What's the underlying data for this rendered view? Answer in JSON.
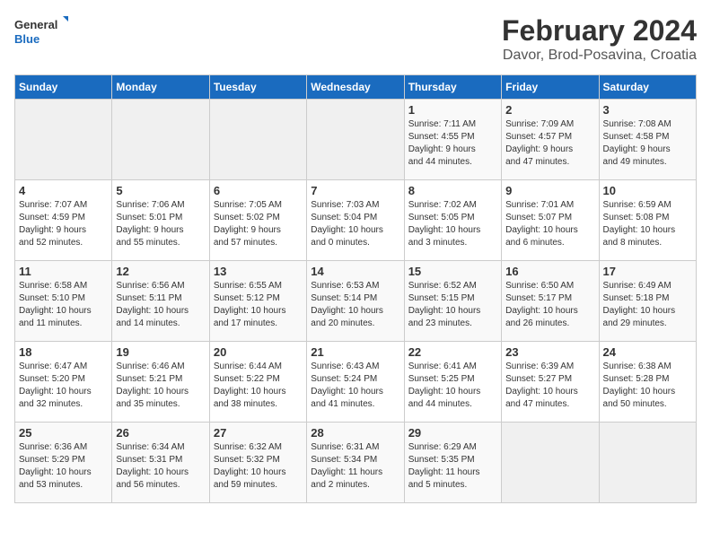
{
  "header": {
    "logo_general": "General",
    "logo_blue": "Blue",
    "title": "February 2024",
    "subtitle": "Davor, Brod-Posavina, Croatia"
  },
  "calendar": {
    "days_of_week": [
      "Sunday",
      "Monday",
      "Tuesday",
      "Wednesday",
      "Thursday",
      "Friday",
      "Saturday"
    ],
    "weeks": [
      {
        "days": [
          {
            "num": "",
            "info": "",
            "empty": true
          },
          {
            "num": "",
            "info": "",
            "empty": true
          },
          {
            "num": "",
            "info": "",
            "empty": true
          },
          {
            "num": "",
            "info": "",
            "empty": true
          },
          {
            "num": "1",
            "info": "Sunrise: 7:11 AM\nSunset: 4:55 PM\nDaylight: 9 hours\nand 44 minutes."
          },
          {
            "num": "2",
            "info": "Sunrise: 7:09 AM\nSunset: 4:57 PM\nDaylight: 9 hours\nand 47 minutes."
          },
          {
            "num": "3",
            "info": "Sunrise: 7:08 AM\nSunset: 4:58 PM\nDaylight: 9 hours\nand 49 minutes."
          }
        ]
      },
      {
        "days": [
          {
            "num": "4",
            "info": "Sunrise: 7:07 AM\nSunset: 4:59 PM\nDaylight: 9 hours\nand 52 minutes."
          },
          {
            "num": "5",
            "info": "Sunrise: 7:06 AM\nSunset: 5:01 PM\nDaylight: 9 hours\nand 55 minutes."
          },
          {
            "num": "6",
            "info": "Sunrise: 7:05 AM\nSunset: 5:02 PM\nDaylight: 9 hours\nand 57 minutes."
          },
          {
            "num": "7",
            "info": "Sunrise: 7:03 AM\nSunset: 5:04 PM\nDaylight: 10 hours\nand 0 minutes."
          },
          {
            "num": "8",
            "info": "Sunrise: 7:02 AM\nSunset: 5:05 PM\nDaylight: 10 hours\nand 3 minutes."
          },
          {
            "num": "9",
            "info": "Sunrise: 7:01 AM\nSunset: 5:07 PM\nDaylight: 10 hours\nand 6 minutes."
          },
          {
            "num": "10",
            "info": "Sunrise: 6:59 AM\nSunset: 5:08 PM\nDaylight: 10 hours\nand 8 minutes."
          }
        ]
      },
      {
        "days": [
          {
            "num": "11",
            "info": "Sunrise: 6:58 AM\nSunset: 5:10 PM\nDaylight: 10 hours\nand 11 minutes."
          },
          {
            "num": "12",
            "info": "Sunrise: 6:56 AM\nSunset: 5:11 PM\nDaylight: 10 hours\nand 14 minutes."
          },
          {
            "num": "13",
            "info": "Sunrise: 6:55 AM\nSunset: 5:12 PM\nDaylight: 10 hours\nand 17 minutes."
          },
          {
            "num": "14",
            "info": "Sunrise: 6:53 AM\nSunset: 5:14 PM\nDaylight: 10 hours\nand 20 minutes."
          },
          {
            "num": "15",
            "info": "Sunrise: 6:52 AM\nSunset: 5:15 PM\nDaylight: 10 hours\nand 23 minutes."
          },
          {
            "num": "16",
            "info": "Sunrise: 6:50 AM\nSunset: 5:17 PM\nDaylight: 10 hours\nand 26 minutes."
          },
          {
            "num": "17",
            "info": "Sunrise: 6:49 AM\nSunset: 5:18 PM\nDaylight: 10 hours\nand 29 minutes."
          }
        ]
      },
      {
        "days": [
          {
            "num": "18",
            "info": "Sunrise: 6:47 AM\nSunset: 5:20 PM\nDaylight: 10 hours\nand 32 minutes."
          },
          {
            "num": "19",
            "info": "Sunrise: 6:46 AM\nSunset: 5:21 PM\nDaylight: 10 hours\nand 35 minutes."
          },
          {
            "num": "20",
            "info": "Sunrise: 6:44 AM\nSunset: 5:22 PM\nDaylight: 10 hours\nand 38 minutes."
          },
          {
            "num": "21",
            "info": "Sunrise: 6:43 AM\nSunset: 5:24 PM\nDaylight: 10 hours\nand 41 minutes."
          },
          {
            "num": "22",
            "info": "Sunrise: 6:41 AM\nSunset: 5:25 PM\nDaylight: 10 hours\nand 44 minutes."
          },
          {
            "num": "23",
            "info": "Sunrise: 6:39 AM\nSunset: 5:27 PM\nDaylight: 10 hours\nand 47 minutes."
          },
          {
            "num": "24",
            "info": "Sunrise: 6:38 AM\nSunset: 5:28 PM\nDaylight: 10 hours\nand 50 minutes."
          }
        ]
      },
      {
        "days": [
          {
            "num": "25",
            "info": "Sunrise: 6:36 AM\nSunset: 5:29 PM\nDaylight: 10 hours\nand 53 minutes."
          },
          {
            "num": "26",
            "info": "Sunrise: 6:34 AM\nSunset: 5:31 PM\nDaylight: 10 hours\nand 56 minutes."
          },
          {
            "num": "27",
            "info": "Sunrise: 6:32 AM\nSunset: 5:32 PM\nDaylight: 10 hours\nand 59 minutes."
          },
          {
            "num": "28",
            "info": "Sunrise: 6:31 AM\nSunset: 5:34 PM\nDaylight: 11 hours\nand 2 minutes."
          },
          {
            "num": "29",
            "info": "Sunrise: 6:29 AM\nSunset: 5:35 PM\nDaylight: 11 hours\nand 5 minutes."
          },
          {
            "num": "",
            "info": "",
            "empty": true
          },
          {
            "num": "",
            "info": "",
            "empty": true
          }
        ]
      }
    ]
  }
}
